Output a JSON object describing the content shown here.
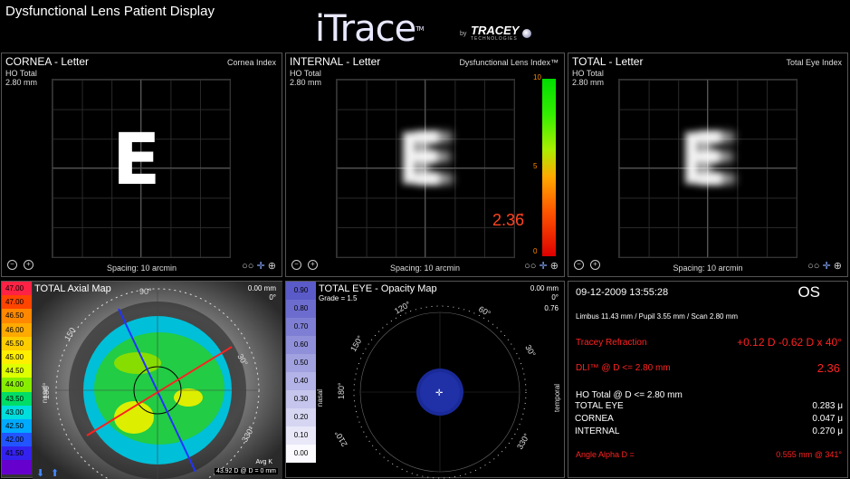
{
  "app": {
    "title": "Dysfunctional Lens Patient Display"
  },
  "logo": {
    "main": "iTrace",
    "tm": "TM",
    "by": "by",
    "brand": "TRACEY",
    "brand_sub": "TECHNOLOGIES"
  },
  "cornea": {
    "title": "CORNEA - Letter",
    "line1": "HO Total",
    "line2": "2.80 mm",
    "right": "Cornea Index",
    "letter": "E",
    "spacing": "Spacing:  10 arcmin"
  },
  "internal": {
    "title": "INTERNAL - Letter",
    "line1": "HO Total",
    "line2": "2.80 mm",
    "right": "Dysfunctional Lens Index™",
    "letter": "E",
    "spacing": "Spacing:  10 arcmin",
    "scale": {
      "top": "10",
      "mid": "5",
      "bottom": "0"
    },
    "dli_value": "2.36",
    "dli_fraction": 0.236
  },
  "total": {
    "title": "TOTAL - Letter",
    "line1": "HO Total",
    "line2": "2.80 mm",
    "right": "Total Eye Index",
    "letter": "E",
    "spacing": "Spacing:  10 arcmin"
  },
  "axial": {
    "title": "TOTAL  Axial Map",
    "top_right": "0.00 mm",
    "top_right2": "0°",
    "nasal": "nasal",
    "avg_k": "Avg K",
    "bottom_readout": "43.92 D @ D = 0 mm",
    "legend": [
      {
        "v": "47.00",
        "c": "#ff2244"
      },
      {
        "v": "47.00",
        "c": "#ff4400"
      },
      {
        "v": "46.50",
        "c": "#ff8800"
      },
      {
        "v": "46.00",
        "c": "#ffaa00"
      },
      {
        "v": "45.50",
        "c": "#ffcc00"
      },
      {
        "v": "45.00",
        "c": "#ffee00"
      },
      {
        "v": "44.50",
        "c": "#ddff00"
      },
      {
        "v": "44.00",
        "c": "#88ee00"
      },
      {
        "v": "43.50",
        "c": "#00dd66"
      },
      {
        "v": "43.00",
        "c": "#00dddd"
      },
      {
        "v": "42.50",
        "c": "#00aaff"
      },
      {
        "v": "42.00",
        "c": "#2255ff"
      },
      {
        "v": "41.50",
        "c": "#3322ee"
      },
      {
        "v": "",
        "c": "#6600cc"
      }
    ]
  },
  "opacity": {
    "title": "TOTAL EYE - Opacity Map",
    "grade": "Grade = 1.5",
    "top_right": "0.00 mm",
    "top_right2": "0°",
    "top_right3": "0.76",
    "nasal": "nasal",
    "temporal": "temporal",
    "legend": [
      "0.90",
      "0.80",
      "0.70",
      "0.60",
      "0.50",
      "0.40",
      "0.30",
      "0.20",
      "0.10",
      "0.00"
    ]
  },
  "info": {
    "date": "09-12-2009  13:55:28",
    "eye": "OS",
    "measures": "Limbus 11.43 mm  /  Pupil 3.55 mm  /  Scan 2.80 mm",
    "refraction_label": "Tracey Refraction",
    "refraction_value": "+0.12 D -0.62 D x 40°",
    "dli_label": "DLI™ @ D <= 2.80 mm",
    "dli_value": "2.36",
    "ho_label": "HO Total @ D <= 2.80 mm",
    "rows": [
      {
        "label": "TOTAL EYE",
        "value": "0.283 μ"
      },
      {
        "label": "CORNEA",
        "value": "0.047 μ"
      },
      {
        "label": "INTERNAL",
        "value": "0.270 μ"
      }
    ],
    "alpha_label": "Angle Alpha D =",
    "alpha_value": "0.555 mm @ 341°"
  },
  "colors": {
    "accent_red": "#ff2222",
    "panel_border": "#555555"
  }
}
